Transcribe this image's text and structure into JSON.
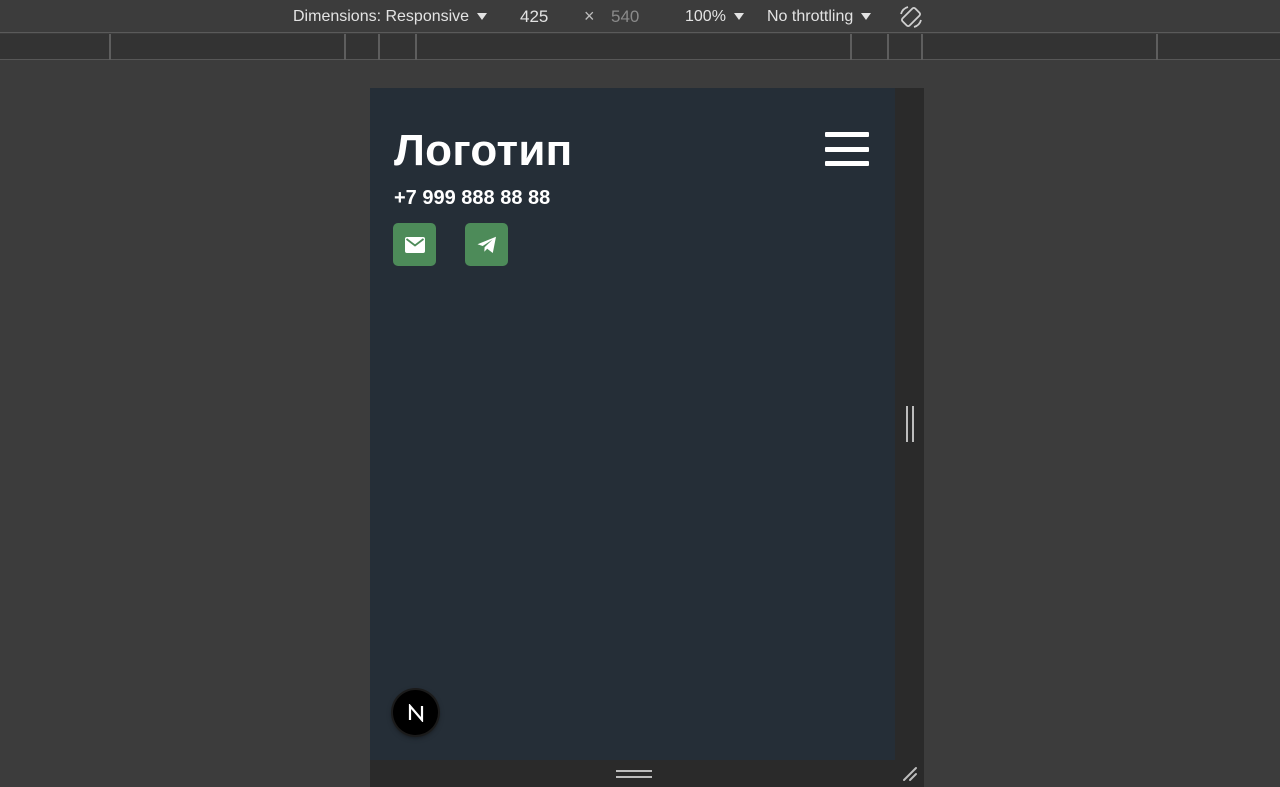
{
  "devtools_toolbar": {
    "dimensions_label": "Dimensions: Responsive",
    "width_value": "425",
    "times_symbol": "×",
    "height_placeholder": "540",
    "zoom_label": "100%",
    "throttling_label": "No throttling",
    "rotate_icon": "rotate-icon"
  },
  "page": {
    "logo_text": "Логотип",
    "phone": "+7 999 888 88 88",
    "menu_icon": "hamburger-menu-icon",
    "contacts": [
      {
        "icon": "mail-icon"
      },
      {
        "icon": "telegram-icon"
      }
    ],
    "dev_badge_letter": "N"
  },
  "colors": {
    "devtools_bg": "#3c3c3c",
    "viewport_bg": "#252e37",
    "contact_button": "#4d8b59",
    "text": "#ffffff"
  }
}
